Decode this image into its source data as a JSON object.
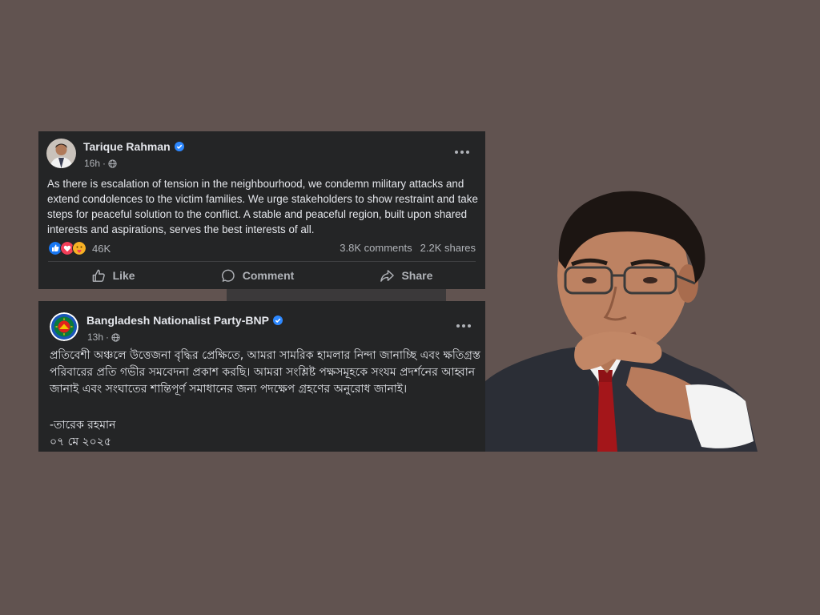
{
  "post1": {
    "author": "Tarique Rahman",
    "time": "16h",
    "text": "As there is escalation of tension in the neighbourhood, we condemn military attacks and extend condolences to the victim families. We urge stakeholders to show restraint and take steps for peaceful solution to the conflict. A stable and peaceful region, built upon shared interests and aspirations, serves the best interests of all.",
    "reactions_count": "46K",
    "comments": "3.8K comments",
    "shares": "2.2K shares",
    "actions": {
      "like": "Like",
      "comment": "Comment",
      "share": "Share"
    }
  },
  "post2": {
    "author": "Bangladesh Nationalist Party-BNP",
    "time": "13h",
    "text": "প্রতিবেশী অঞ্চলে উত্তেজনা বৃদ্ধির প্রেক্ষিতে, আমরা সামরিক হামলার নিন্দা জানাচ্ছি এবং ক্ষতিগ্রস্ত পরিবারের প্রতি গভীর সমবেদনা প্রকাশ করছি। আমরা সংশ্লিষ্ট পক্ষসমূহকে সংযম প্রদর্শনের আহ্বান জানাই এবং সংঘাতের শান্তিপূর্ণ সমাধানের জন্য পদক্ষেপ গ্রহণের অনুরোধ জানাই।",
    "signature": "-তারেক রহমান",
    "date": "০৭ মে ২০২৫"
  },
  "colors": {
    "background": "#615350",
    "card": "#242526",
    "text": "#e4e6eb",
    "secondary_text": "#b0b3b8",
    "verified": "#2d88ff"
  },
  "icons": [
    "verified-badge-icon",
    "globe-icon",
    "more-options-icon",
    "like-reaction-icon",
    "love-reaction-icon",
    "care-reaction-icon",
    "thumbs-up-icon",
    "comment-icon",
    "share-icon"
  ]
}
